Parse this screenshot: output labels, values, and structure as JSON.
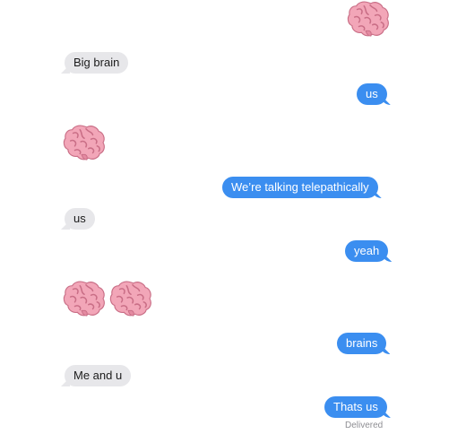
{
  "conversation": {
    "messages": [
      {
        "side": "sent",
        "type": "emoji",
        "icon": "brain-icon",
        "count": 1
      },
      {
        "side": "received",
        "type": "text",
        "text": "Big brain"
      },
      {
        "side": "sent",
        "type": "text",
        "text": "us"
      },
      {
        "side": "received",
        "type": "emoji",
        "icon": "brain-icon",
        "count": 1
      },
      {
        "side": "sent",
        "type": "text",
        "text": "We’re talking telepathically"
      },
      {
        "side": "received",
        "type": "text",
        "text": "us"
      },
      {
        "side": "sent",
        "type": "text",
        "text": "yeah"
      },
      {
        "side": "received",
        "type": "emoji",
        "icon": "brain-icon",
        "count": 2
      },
      {
        "side": "sent",
        "type": "text",
        "text": "brains"
      },
      {
        "side": "received",
        "type": "text",
        "text": "Me and u"
      },
      {
        "side": "sent",
        "type": "text",
        "text": "Thats us"
      }
    ],
    "status": "Delivered"
  },
  "colors": {
    "sent_bubble": "#3b8ef0",
    "received_bubble": "#e7e7ea",
    "brain": "#f2a6b8"
  }
}
